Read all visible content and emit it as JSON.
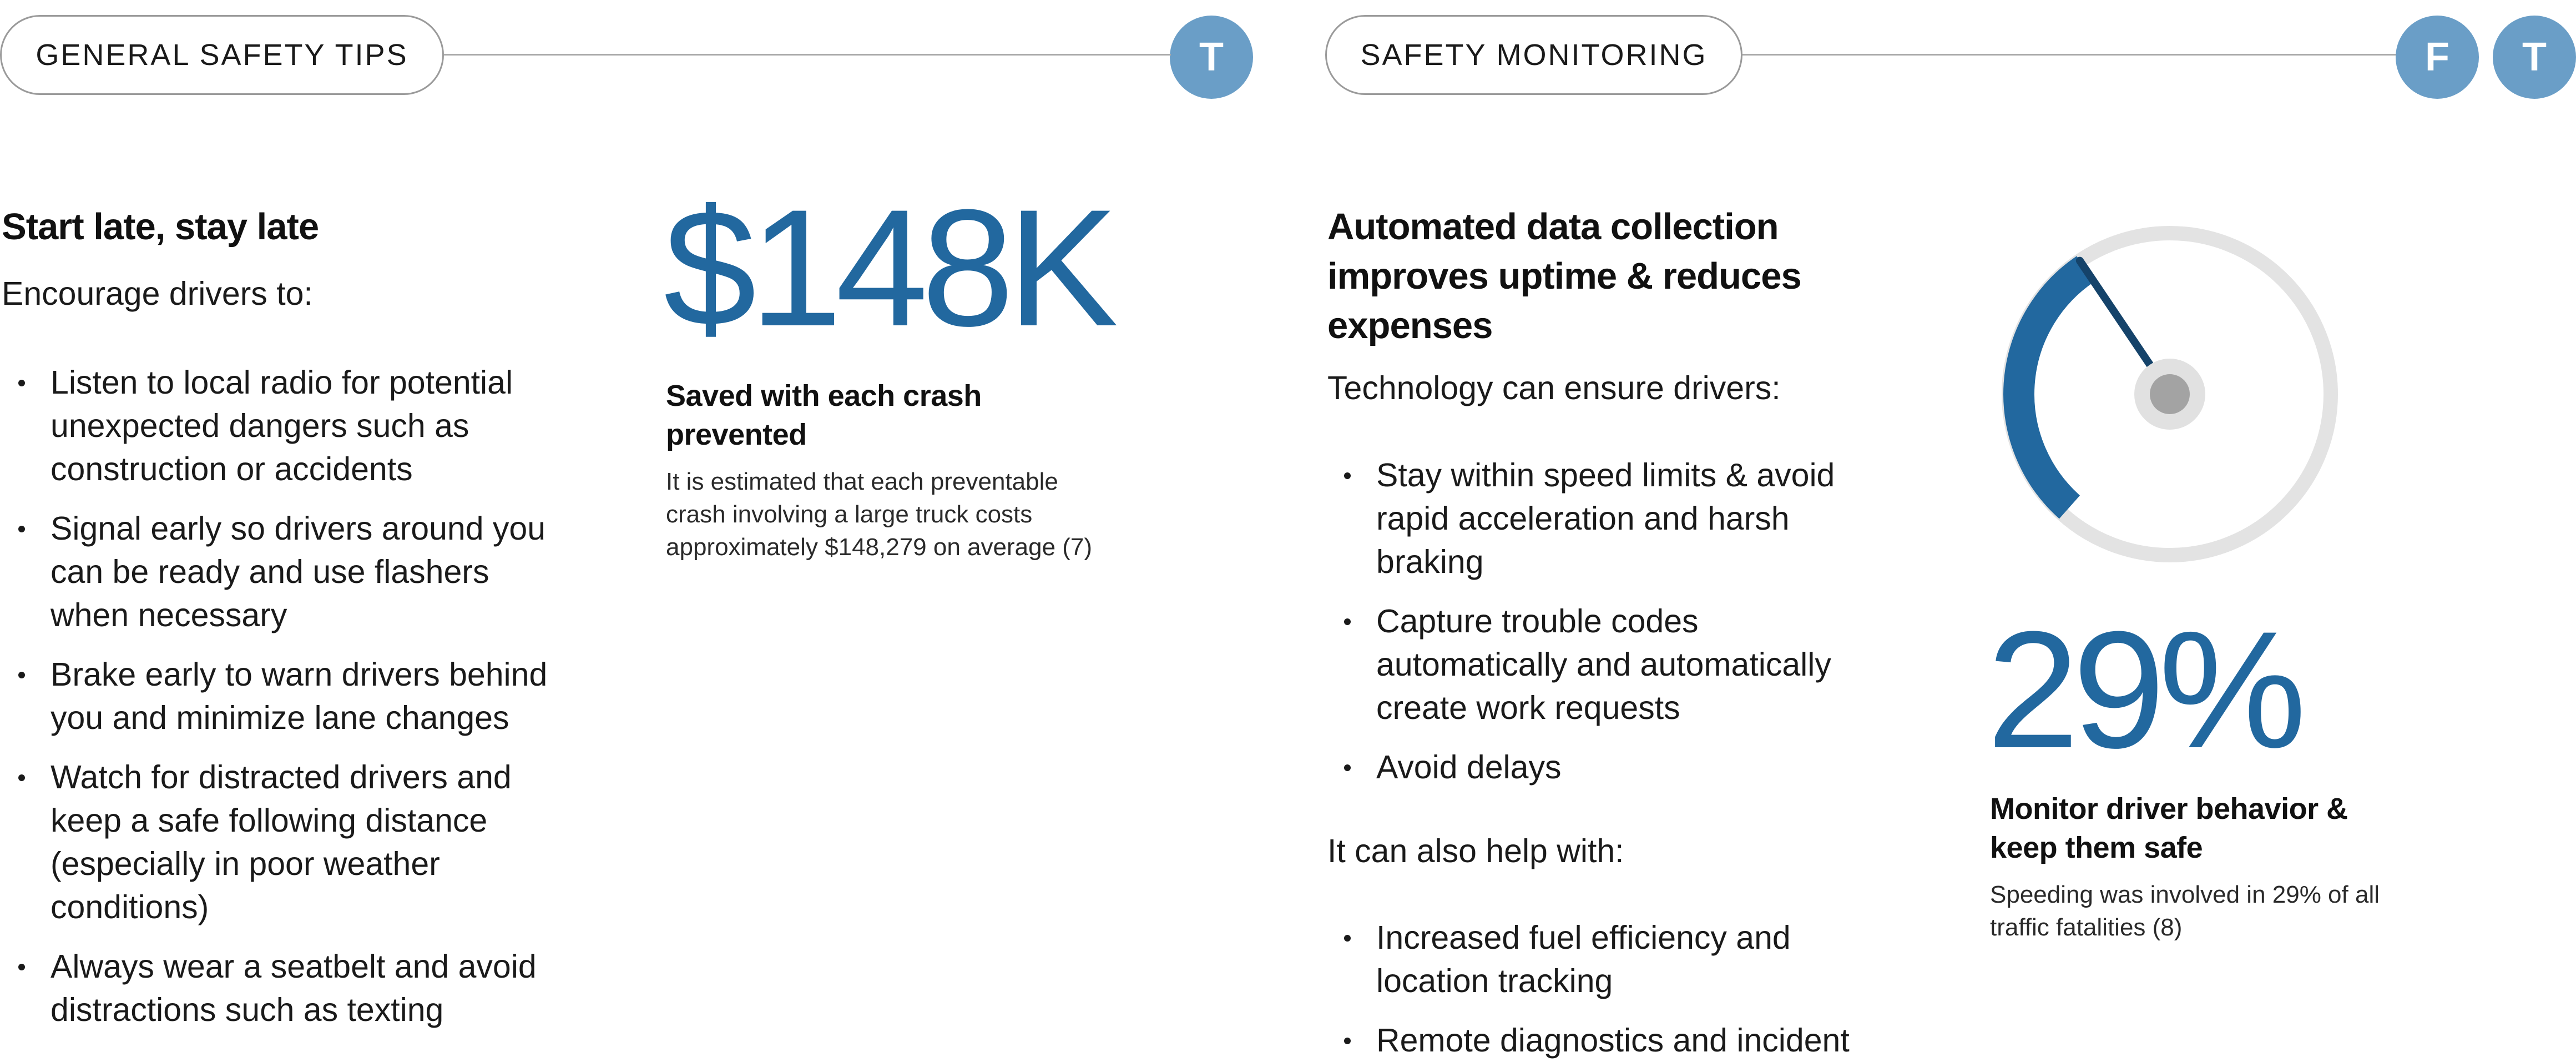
{
  "left_panel": {
    "header_label": "GENERAL SAFETY TIPS",
    "header_badge": "T",
    "heading": "Start late, stay late",
    "intro": "Encourage drivers to:",
    "tips": [
      "Listen to local radio for potential unexpected dangers such as construction or accidents",
      "Signal early so drivers around you can be ready and use flashers when necessary",
      "Brake early to warn drivers behind you and minimize lane changes",
      "Watch for distracted drivers and keep a safe following distance (especially in poor weather conditions)",
      "Always wear a seatbelt and avoid distractions such as texting"
    ],
    "stat": {
      "value": "$148K",
      "title": "Saved with each crash prevented",
      "description": "It is estimated that each preventable crash involving a large truck costs approximately $148,279 on average (7)"
    }
  },
  "right_panel": {
    "header_label": "SAFETY MONITORING",
    "header_badges": [
      "F",
      "T"
    ],
    "heading": "Automated data collection improves uptime & reduces expenses",
    "intro": "Technology can ensure drivers:",
    "bullets": [
      "Stay within speed limits & avoid rapid acceleration and harsh braking",
      "Capture trouble codes automatically and automatically create work requests",
      "Avoid delays"
    ],
    "intro2": "It can also help with:",
    "bullets2": [
      "Increased fuel efficiency and location tracking",
      "Remote diagnostics and incident"
    ],
    "stat": {
      "value": "29%",
      "gauge_fraction": 0.29,
      "title": "Monitor driver behavior & keep them safe",
      "description": "Speeding was involved in 29% of all traffic fatalities (8)"
    }
  },
  "colors": {
    "accent": "#22689f",
    "badge": "#6a9ec7",
    "gauge_track": "#e3e3e3",
    "needle_hub": "#a3a3a3"
  }
}
